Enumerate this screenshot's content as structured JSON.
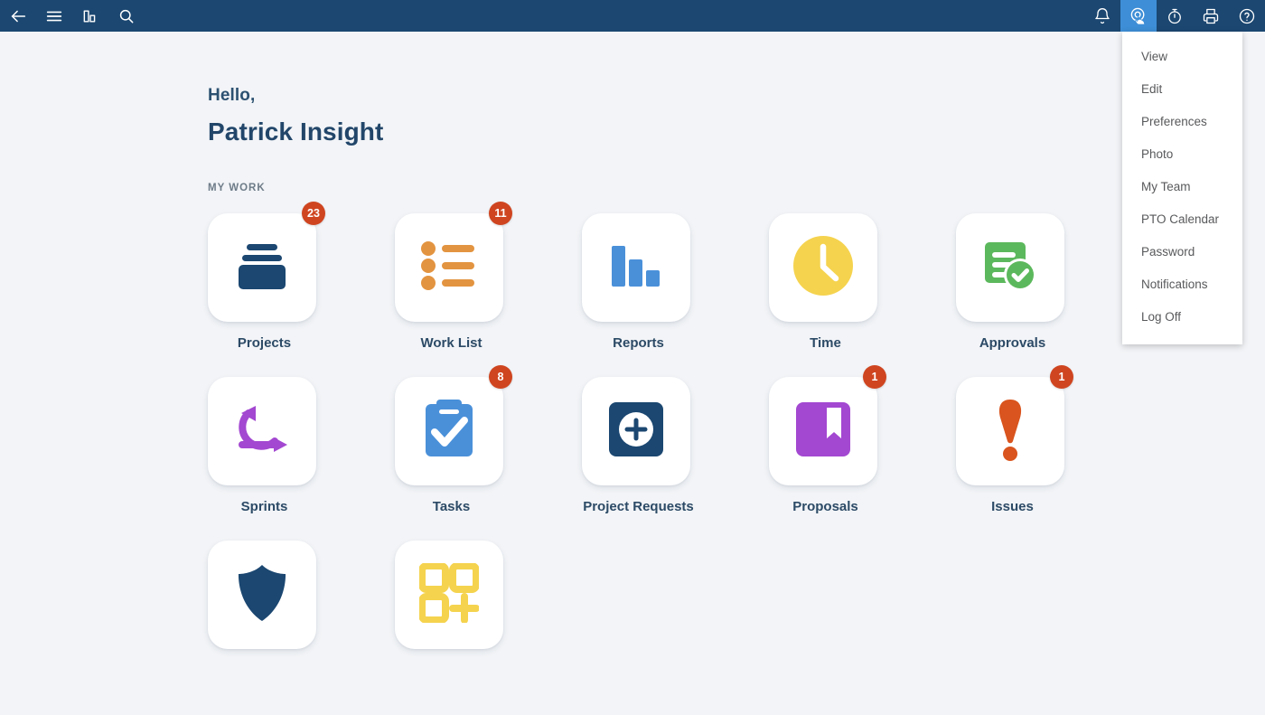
{
  "topbar": {
    "background": "#1b4771",
    "active_background": "#3d8ed6",
    "left_icons": [
      {
        "name": "back-arrow-icon",
        "label": "Back"
      },
      {
        "name": "hamburger-menu-icon",
        "label": "Menu"
      },
      {
        "name": "bar-chart-icon",
        "label": "Analytics"
      },
      {
        "name": "search-icon",
        "label": "Search"
      }
    ],
    "right_icons": [
      {
        "name": "bell-icon",
        "label": "Notifications",
        "active": false
      },
      {
        "name": "user-touch-icon",
        "label": "My Account",
        "active": true
      },
      {
        "name": "stopwatch-icon",
        "label": "Timer",
        "active": false
      },
      {
        "name": "printer-icon",
        "label": "Print",
        "active": false
      },
      {
        "name": "help-circle-icon",
        "label": "Help",
        "active": false
      }
    ]
  },
  "dropdown": {
    "items": [
      {
        "label": "View"
      },
      {
        "label": "Edit"
      },
      {
        "label": "Preferences"
      },
      {
        "label": "Photo"
      },
      {
        "label": "My Team"
      },
      {
        "label": "PTO Calendar"
      },
      {
        "label": "Password"
      },
      {
        "label": "Notifications"
      },
      {
        "label": "Log Off"
      }
    ]
  },
  "greeting": {
    "hello": "Hello,",
    "name": "Patrick Insight"
  },
  "my_work": {
    "section_label": "MY WORK",
    "tiles": [
      {
        "label": "Projects",
        "icon": "projects-icon",
        "badge": "23",
        "color": "#1b4771"
      },
      {
        "label": "Work List",
        "icon": "work-list-icon",
        "badge": "11",
        "color": "#e39440"
      },
      {
        "label": "Reports",
        "icon": "reports-icon",
        "badge": "",
        "color": "#4a90d9"
      },
      {
        "label": "Time",
        "icon": "clock-icon",
        "badge": "",
        "color": "#f5d34e"
      },
      {
        "label": "Approvals",
        "icon": "approvals-icon",
        "badge": "",
        "color": "#5cb85c"
      },
      {
        "label": "Sprints",
        "icon": "sprints-icon",
        "badge": "",
        "color": "#a348d1"
      },
      {
        "label": "Tasks",
        "icon": "tasks-icon",
        "badge": "8",
        "color": "#4a90d9"
      },
      {
        "label": "Project Requests",
        "icon": "project-requests-icon",
        "badge": "",
        "color": "#1b4771"
      },
      {
        "label": "Proposals",
        "icon": "proposals-icon",
        "badge": "1",
        "color": "#a348d1"
      },
      {
        "label": "Issues",
        "icon": "issues-icon",
        "badge": "1",
        "color": "#d9541e"
      },
      {
        "label": "",
        "icon": "shield-icon",
        "badge": "",
        "color": "#1b4771"
      },
      {
        "label": "",
        "icon": "grid-plus-icon",
        "badge": "",
        "color": "#f5d34e"
      }
    ]
  }
}
